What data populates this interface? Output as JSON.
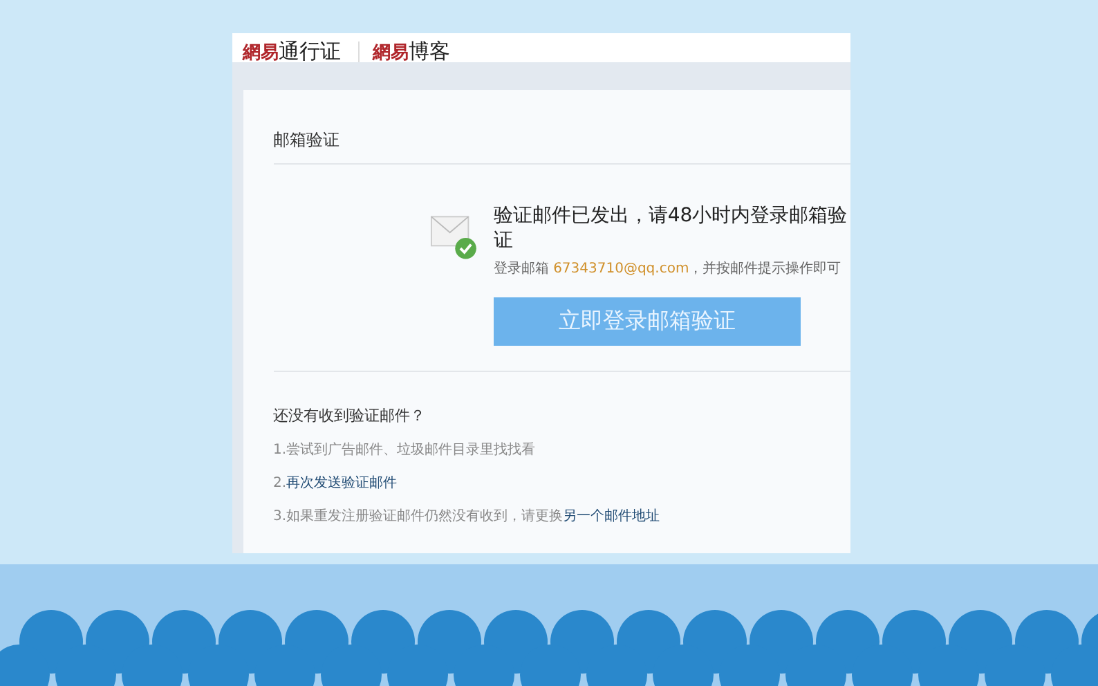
{
  "header": {
    "logos": [
      {
        "mark": "網易",
        "name": "通行证"
      },
      {
        "mark": "網易",
        "name": "博客"
      }
    ]
  },
  "panel": {
    "title": "邮箱验证",
    "notice": {
      "heading": "验证邮件已发出，请48小时内登录邮箱验证",
      "detail_prefix": "登录邮箱",
      "email": "67343710@qq.com",
      "detail_suffix": "，并按邮件提示操作即可",
      "button": "立即登录邮箱验证"
    },
    "help": {
      "title": "还没有收到验证邮件？",
      "items": [
        {
          "text": "1.尝试到广告邮件、垃圾邮件目录里找找看"
        },
        {
          "text": "2.",
          "link": "再次发送验证邮件"
        },
        {
          "text": "3.如果重发注册验证邮件仍然没有收到，请更换",
          "link": "另一个邮件地址"
        }
      ]
    }
  }
}
